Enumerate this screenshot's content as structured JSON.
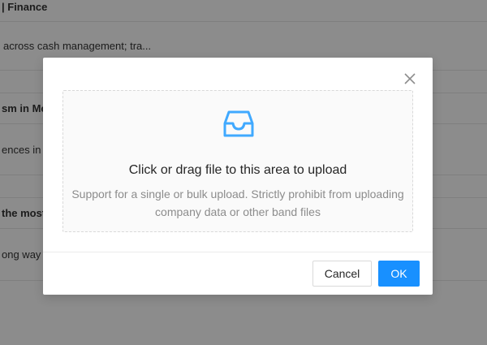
{
  "background": {
    "rows": [
      {
        "text": "| Finance",
        "type": "title"
      },
      {
        "text": "across cash management; tra...",
        "type": "text"
      },
      {
        "text": "",
        "type": "text"
      },
      {
        "text": "sm in Mo",
        "type": "title"
      },
      {
        "text": "ences in",
        "type": "text"
      },
      {
        "text": "",
        "type": "text"
      },
      {
        "text": "the most",
        "type": "title"
      },
      {
        "text": "ong way",
        "type": "text"
      }
    ]
  },
  "modal": {
    "close_icon": "close-icon",
    "dropzone": {
      "icon": "inbox-icon",
      "accent_color": "#40a9ff",
      "text": "Click or drag file to this area to upload",
      "hint": "Support for a single or bulk upload. Strictly prohibit from uploading company data or other band files"
    },
    "footer": {
      "cancel_label": "Cancel",
      "ok_label": "OK",
      "primary_color": "#1890ff"
    }
  }
}
